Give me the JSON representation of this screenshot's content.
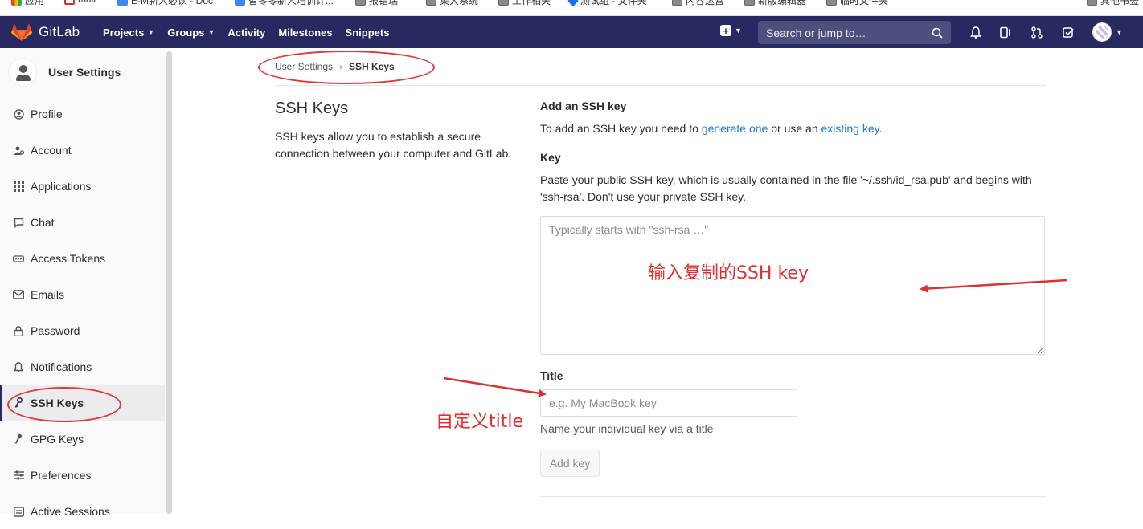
{
  "bookmarks": [
    {
      "label": "应用",
      "icon": "apps-grid-icon"
    },
    {
      "label": "mail",
      "icon": "gmail-icon"
    },
    {
      "label": "E-M新人必读 - Doc",
      "icon": "doc-icon"
    },
    {
      "label": "智零零新人培训计...",
      "icon": "doc-icon"
    },
    {
      "label": "报错瑞",
      "icon": "folder-icon"
    },
    {
      "label": "集大系统",
      "icon": "folder-icon"
    },
    {
      "label": "工作相关",
      "icon": "folder-icon"
    },
    {
      "label": "测试组 - 文件夹",
      "icon": "drive-icon"
    },
    {
      "label": "内容运营",
      "icon": "folder-icon"
    },
    {
      "label": "新版编辑器",
      "icon": "folder-icon"
    },
    {
      "label": "临时文件夹",
      "icon": "folder-icon"
    },
    {
      "label": "其他书签",
      "icon": "folder-icon"
    }
  ],
  "navbar": {
    "brand": "GitLab",
    "links": [
      "Projects",
      "Groups",
      "Activity",
      "Milestones",
      "Snippets"
    ],
    "search_placeholder": "Search or jump to…",
    "brand_color": "#292961"
  },
  "sidebar": {
    "title": "User Settings",
    "items": [
      {
        "label": "Profile",
        "icon": "profile-icon"
      },
      {
        "label": "Account",
        "icon": "account-icon"
      },
      {
        "label": "Applications",
        "icon": "applications-icon"
      },
      {
        "label": "Chat",
        "icon": "chat-icon"
      },
      {
        "label": "Access Tokens",
        "icon": "token-icon"
      },
      {
        "label": "Emails",
        "icon": "email-icon"
      },
      {
        "label": "Password",
        "icon": "lock-icon"
      },
      {
        "label": "Notifications",
        "icon": "bell-icon"
      },
      {
        "label": "SSH Keys",
        "icon": "key-icon",
        "active": true
      },
      {
        "label": "GPG Keys",
        "icon": "key-icon"
      },
      {
        "label": "Preferences",
        "icon": "sliders-icon"
      },
      {
        "label": "Active Sessions",
        "icon": "sessions-icon"
      }
    ]
  },
  "breadcrumb": {
    "parent": "User Settings",
    "current": "SSH Keys"
  },
  "page": {
    "title": "SSH Keys",
    "description": "SSH keys allow you to establish a secure connection between your computer and GitLab."
  },
  "form": {
    "heading": "Add an SSH key",
    "intro_prefix": "To add an SSH key you need to ",
    "intro_link1": "generate one",
    "intro_middle": " or use an ",
    "intro_link2": "existing key",
    "intro_suffix": ".",
    "key_label": "Key",
    "key_help": "Paste your public SSH key, which is usually contained in the file '~/.ssh/id_rsa.pub' and begins with 'ssh-rsa'. Don't use your private SSH key.",
    "key_placeholder": "Typically starts with \"ssh-rsa …\"",
    "title_label": "Title",
    "title_placeholder": "e.g. My MacBook key",
    "title_help": "Name your individual key via a title",
    "submit": "Add key"
  },
  "annotations": {
    "key_note": "输入复制的SSH key",
    "title_note": "自定义title",
    "color": "#e02f2f"
  }
}
